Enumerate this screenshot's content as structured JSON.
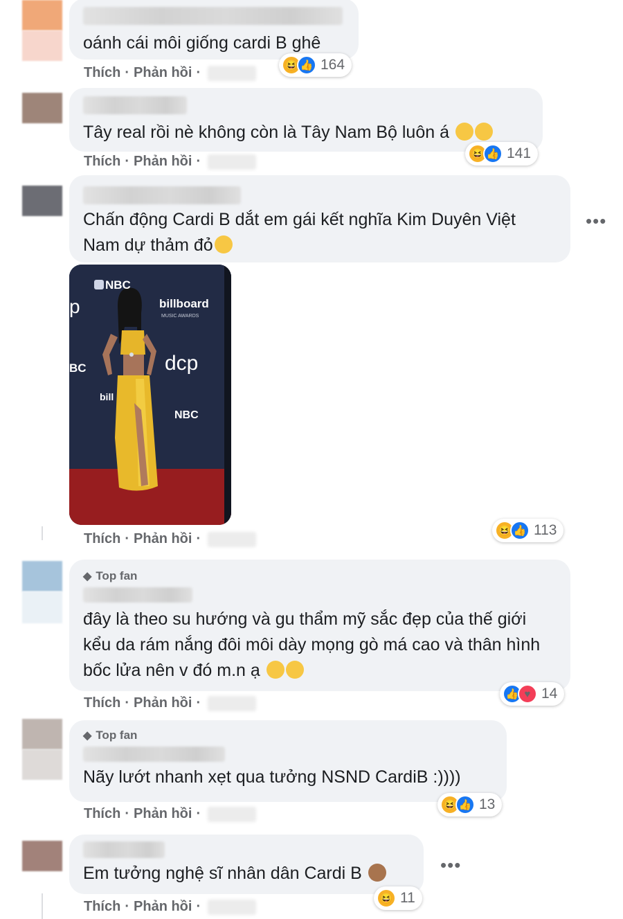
{
  "actions": {
    "like": "Thích",
    "reply": "Phản hồi",
    "sep": "·"
  },
  "badge": "Top fan",
  "comments": [
    {
      "text": "oánh cái môi giống cardi B ghê",
      "reactions": "164"
    },
    {
      "text": "Tây real rồi nè không còn là Tây Nam Bộ luôn á",
      "reactions": "141"
    },
    {
      "text": "Chấn động Cardi B dắt em gái kết nghĩa Kim Duyên Việt Nam dự thảm đỏ",
      "reactions": "113"
    },
    {
      "text": "đây là theo su hướng và gu thẩm mỹ sắc đẹp của thế giới kểu da rám nắng đôi môi dày mọng gò má cao và thân hình bốc lửa nên v đó m.n ạ",
      "reactions": "14"
    },
    {
      "text": "Nãy lướt nhanh xẹt qua tưởng NSND CardiB :))))",
      "reactions": "13"
    },
    {
      "text": "Em tưởng nghệ sĩ nhân dân Cardi B",
      "reactions": "11"
    }
  ],
  "photo": {
    "logo": "NBC",
    "brand": "billboard",
    "brand_sub": "MUSIC AWARDS",
    "logo2": "dcp"
  },
  "more_icon": "•••",
  "colors": {
    "bubble": "#f0f2f5",
    "action": "#65676b",
    "like": "#1877f2",
    "haha": "#f7b125",
    "love": "#f33e58"
  }
}
